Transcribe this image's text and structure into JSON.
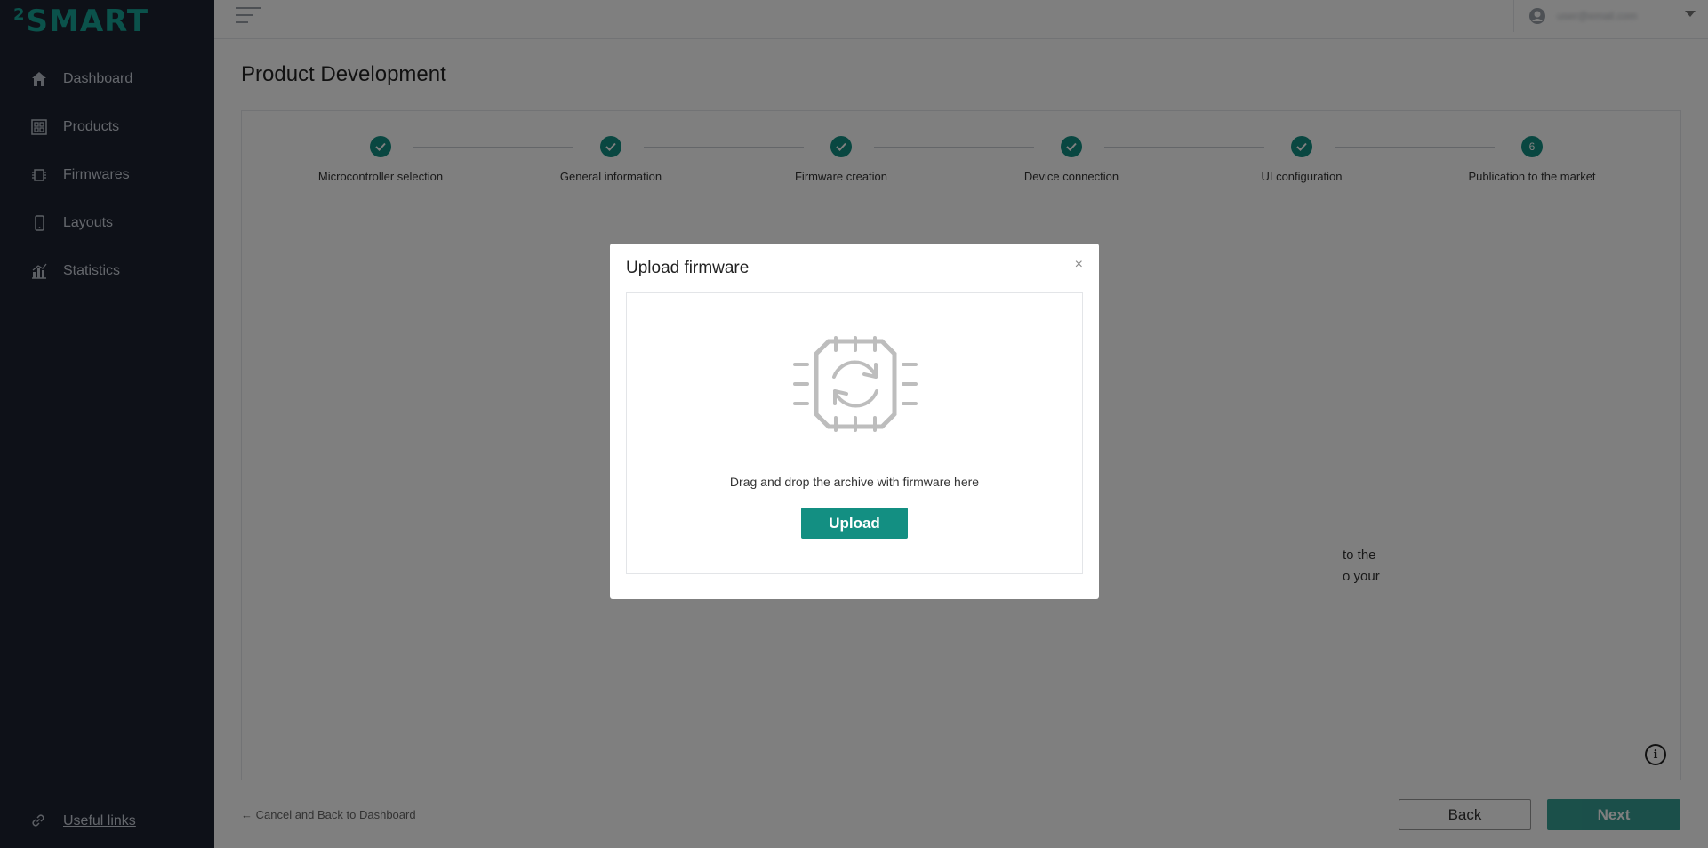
{
  "logo": {
    "sup": "2",
    "text": "SMART"
  },
  "sidebar": {
    "items": [
      {
        "label": "Dashboard",
        "icon": "home-icon"
      },
      {
        "label": "Products",
        "icon": "products-icon"
      },
      {
        "label": "Firmwares",
        "icon": "chip-icon"
      },
      {
        "label": "Layouts",
        "icon": "phone-icon"
      },
      {
        "label": "Statistics",
        "icon": "bar-chart-icon"
      }
    ],
    "useful_links": "Useful links"
  },
  "header": {
    "user_email": "user@email.com"
  },
  "page": {
    "title": "Product Development"
  },
  "steps": [
    {
      "label": "Microcontroller selection",
      "status": "done"
    },
    {
      "label": "General information",
      "status": "done"
    },
    {
      "label": "Firmware creation",
      "status": "done"
    },
    {
      "label": "Device connection",
      "status": "done"
    },
    {
      "label": "UI configuration",
      "status": "done"
    },
    {
      "label": "Publication to the market",
      "status": "current",
      "number": "6"
    }
  ],
  "background_text": {
    "line1": "to the",
    "line2": "o your"
  },
  "footer": {
    "cancel_label": "Cancel and Back to Dashboard",
    "back_label": "Back",
    "next_label": "Next"
  },
  "modal": {
    "title": "Upload firmware",
    "close": "×",
    "drop_text": "Drag and drop the archive with firmware here",
    "upload_label": "Upload"
  },
  "colors": {
    "accent": "#138f82",
    "sidebar_bg": "#1c2230",
    "logo": "#17a596"
  }
}
